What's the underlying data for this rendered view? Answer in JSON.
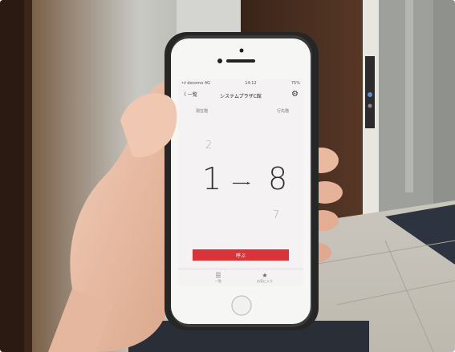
{
  "phone": {
    "status_left": "•ıl docomo 4G",
    "status_time": "14:12",
    "status_right": "75%",
    "back_label": "〈 一覧",
    "title": "システムプラザC館",
    "gear_icon": "gear-icon",
    "left_label": "現在階",
    "right_label": "行先階",
    "prev_floor": "2",
    "current_floor": "1",
    "destination_floor": "8",
    "next_floor": "7",
    "call_button": "呼ぶ",
    "tabs": [
      {
        "icon": "list-icon",
        "label": "一覧"
      },
      {
        "icon": "star-icon",
        "label": "お気に入り"
      }
    ]
  },
  "colors": {
    "call_button": "#d8343a",
    "screen_bg": "#f4f2f3",
    "case": "#2b2b2b"
  }
}
